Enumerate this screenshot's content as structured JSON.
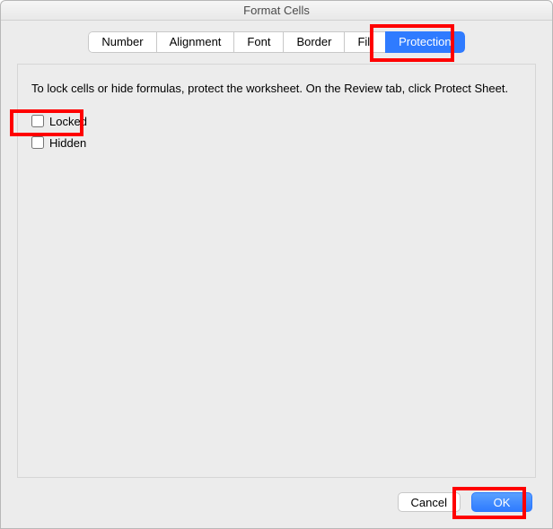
{
  "window": {
    "title": "Format Cells"
  },
  "tabs": {
    "items": [
      {
        "label": "Number"
      },
      {
        "label": "Alignment"
      },
      {
        "label": "Font"
      },
      {
        "label": "Border"
      },
      {
        "label": "Fill"
      },
      {
        "label": "Protection",
        "selected": true
      }
    ]
  },
  "protection": {
    "info": "To lock cells or hide formulas, protect the worksheet. On the Review tab, click Protect Sheet.",
    "locked_label": "Locked",
    "hidden_label": "Hidden",
    "locked_checked": false,
    "hidden_checked": false
  },
  "buttons": {
    "cancel": "Cancel",
    "ok": "OK"
  },
  "highlight_color": "#ff0000"
}
